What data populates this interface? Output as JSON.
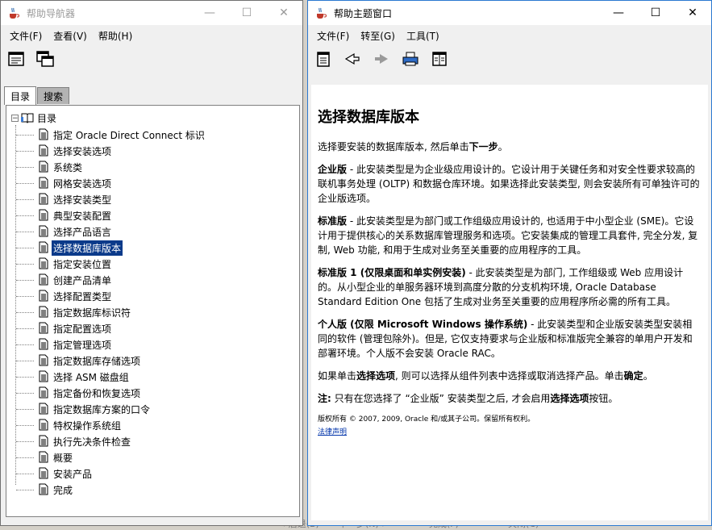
{
  "nav_window": {
    "title": "帮助导航器",
    "controls": [
      "—",
      "☐",
      "✕"
    ],
    "menu": [
      "文件(F)",
      "查看(V)",
      "帮助(H)"
    ],
    "tabs": [
      "目录",
      "搜索"
    ],
    "tree_root": "目录",
    "tree_items": [
      "指定 Oracle Direct Connect 标识",
      "选择安装选项",
      "系统类",
      "网格安装选项",
      "选择安装类型",
      "典型安装配置",
      "选择产品语言",
      "选择数据库版本",
      "指定安装位置",
      "创建产品清单",
      "选择配置类型",
      "指定数据库标识符",
      "指定配置选项",
      "指定管理选项",
      "指定数据库存储选项",
      "选择 ASM 磁盘组",
      "指定备份和恢复选项",
      "指定数据库方案的口令",
      "特权操作系统组",
      "执行先决条件检查",
      "概要",
      "安装产品",
      "完成"
    ],
    "selected_index": 7
  },
  "topic_window": {
    "title": "帮助主题窗口",
    "controls": [
      "—",
      "☐",
      "✕"
    ],
    "menu": [
      "文件(F)",
      "转至(G)",
      "工具(T)"
    ],
    "heading": "选择数据库版本",
    "intro_pre": "选择要安装的数据库版本, 然后单击",
    "intro_bold": "下一步",
    "intro_post": "。",
    "p_enterprise_bold": "企业版",
    "p_enterprise": " - 此安装类型是为企业级应用设计的。它设计用于关键任务和对安全性要求较高的联机事务处理 (OLTP) 和数据仓库环境。如果选择此安装类型, 则会安装所有可单独许可的企业版选项。",
    "p_standard_bold": "标准版",
    "p_standard": " - 此安装类型是为部门或工作组级应用设计的, 也适用于中小型企业 (SME)。它设计用于提供核心的关系数据库管理服务和选项。它安装集成的管理工具套件, 完全分发, 复制, Web 功能, 和用于生成对业务至关重要的应用程序的工具。",
    "p_se1_bold": "标准版 1 (仅限桌面和单实例安装)",
    "p_se1": " - 此安装类型是为部门, 工作组级或 Web 应用设计的。从小型企业的单服务器环境到高度分散的分支机构环境, Oracle Database Standard Edition One 包括了生成对业务至关重要的应用程序所必需的所有工具。",
    "p_personal_bold": "个人版 (仅限 Microsoft Windows 操作系统)",
    "p_personal": " - 此安装类型和企业版安装类型安装相同的软件 (管理包除外)。但是, 它仅支持要求与企业版和标准版完全兼容的单用户开发和部署环境。个人版不会安装 Oracle RAC。",
    "p_click_pre": "如果单击",
    "p_click_bold1": "选择选项",
    "p_click_mid": ", 则可以选择从组件列表中选择或取消选择产品。单击",
    "p_click_bold2": "确定",
    "p_click_post": "。",
    "note_bold": "注:",
    "note_pre": " 只有在您选择了 “企业版” 安装类型之后, 才会启用",
    "note_bold2": "选择选项",
    "note_post": "按钮。",
    "copyright": "版权所有 © 2007, 2009, Oracle 和/或其子公司。保留所有权利。",
    "legal_link": "法律声明"
  },
  "background_dialog": {
    "buttons": [
      "< 后退(B)",
      "下一步(N) >",
      "完成(F)",
      "关闭(C)"
    ]
  },
  "colors": {
    "selection": "#0b3a8a",
    "active_border": "#2b79d1",
    "link": "#0033aa"
  }
}
